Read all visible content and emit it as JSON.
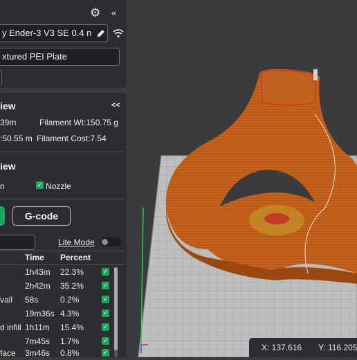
{
  "printer": {
    "name": "y Ender-3 V3 SE 0.4 n",
    "plate": "xtured PEI Plate"
  },
  "slice_preview": {
    "title": "iew",
    "time_fragment": "39m",
    "filament_weight": "Filament Wt:150.75 g",
    "time_fragment_2": ":50.55 m",
    "filament_cost": "Filament Cost:7.54",
    "collapse_glyph": "<<"
  },
  "view_section": {
    "title": "iew",
    "option_left": "n",
    "nozzle_label": "Nozzle"
  },
  "buttons": {
    "gcode": "G-code"
  },
  "lite_mode": {
    "label": "Lite Mode"
  },
  "table": {
    "headers": {
      "time": "Time",
      "percent": "Percent"
    },
    "rows": [
      {
        "name": "",
        "time": "1h43m",
        "percent": "22.3%"
      },
      {
        "name": "",
        "time": "2h42m",
        "percent": "35.2%"
      },
      {
        "name": "vall",
        "time": "58s",
        "percent": "0.2%"
      },
      {
        "name": "",
        "time": "19m36s",
        "percent": "4.3%"
      },
      {
        "name": "d infill",
        "time": "1h11m",
        "percent": "15.4%"
      },
      {
        "name": "",
        "time": "7m45s",
        "percent": "1.7%"
      },
      {
        "name": "face",
        "time": "3m46s",
        "percent": "0.8%"
      }
    ]
  },
  "viewport": {
    "x_label": "X: 137.616",
    "y_label": "Y: 116.205"
  },
  "icons": {
    "settings": "gear-icon",
    "collapse": "double-chevron-left-icon",
    "edit": "pencil-icon",
    "wifi": "wifi-icon"
  },
  "colors": {
    "accent_green": "#1fa85b",
    "model_orange": "#c8641e",
    "panel_bg": "#2c2d30",
    "viewport_bg": "#3a3b3d"
  }
}
